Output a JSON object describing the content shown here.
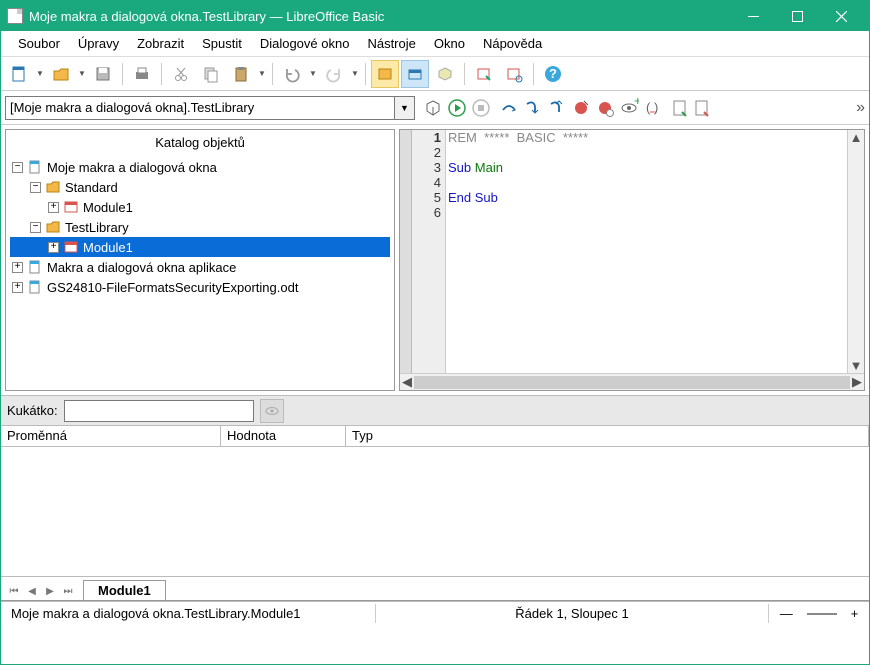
{
  "titlebar": {
    "title": "Moje makra a dialogová okna.TestLibrary — LibreOffice Basic"
  },
  "menu": [
    "Soubor",
    "Úpravy",
    "Zobrazit",
    "Spustit",
    "Dialogové okno",
    "Nástroje",
    "Okno",
    "Nápověda"
  ],
  "combo": {
    "value": "[Moje makra a dialogová okna].TestLibrary"
  },
  "catalog": {
    "title": "Katalog objektů",
    "rows": [
      {
        "indent": 0,
        "ex": "-",
        "icon": "doc",
        "label": "Moje makra a dialogová okna"
      },
      {
        "indent": 1,
        "ex": "-",
        "icon": "folder",
        "label": "Standard"
      },
      {
        "indent": 2,
        "ex": "+",
        "icon": "module",
        "label": "Module1"
      },
      {
        "indent": 1,
        "ex": "-",
        "icon": "folder",
        "label": "TestLibrary"
      },
      {
        "indent": 2,
        "ex": "+",
        "icon": "module",
        "label": "Module1",
        "selected": true
      },
      {
        "indent": 0,
        "ex": "+",
        "icon": "doc",
        "label": "Makra a dialogová okna aplikace"
      },
      {
        "indent": 0,
        "ex": "+",
        "icon": "doc",
        "label": "GS24810-FileFormatsSecurityExporting.odt"
      }
    ]
  },
  "code": {
    "lines": [
      {
        "n": 1,
        "type": "comment",
        "text": "REM  *****  BASIC  *****"
      },
      {
        "n": 2,
        "type": "blank",
        "text": ""
      },
      {
        "n": 3,
        "type": "sub",
        "kw": "Sub",
        "id": "Main"
      },
      {
        "n": 4,
        "type": "blank",
        "text": ""
      },
      {
        "n": 5,
        "type": "endsub",
        "kw": "End Sub"
      },
      {
        "n": 6,
        "type": "blank",
        "text": ""
      }
    ]
  },
  "watch": {
    "label": "Kukátko:"
  },
  "vars": {
    "col1": "Proměnná",
    "col2": "Hodnota",
    "col3": "Typ"
  },
  "tabs": {
    "active": "Module1"
  },
  "status": {
    "path": "Moje makra a dialogová okna.TestLibrary.Module1",
    "pos": "Řádek 1, Sloupec 1"
  }
}
